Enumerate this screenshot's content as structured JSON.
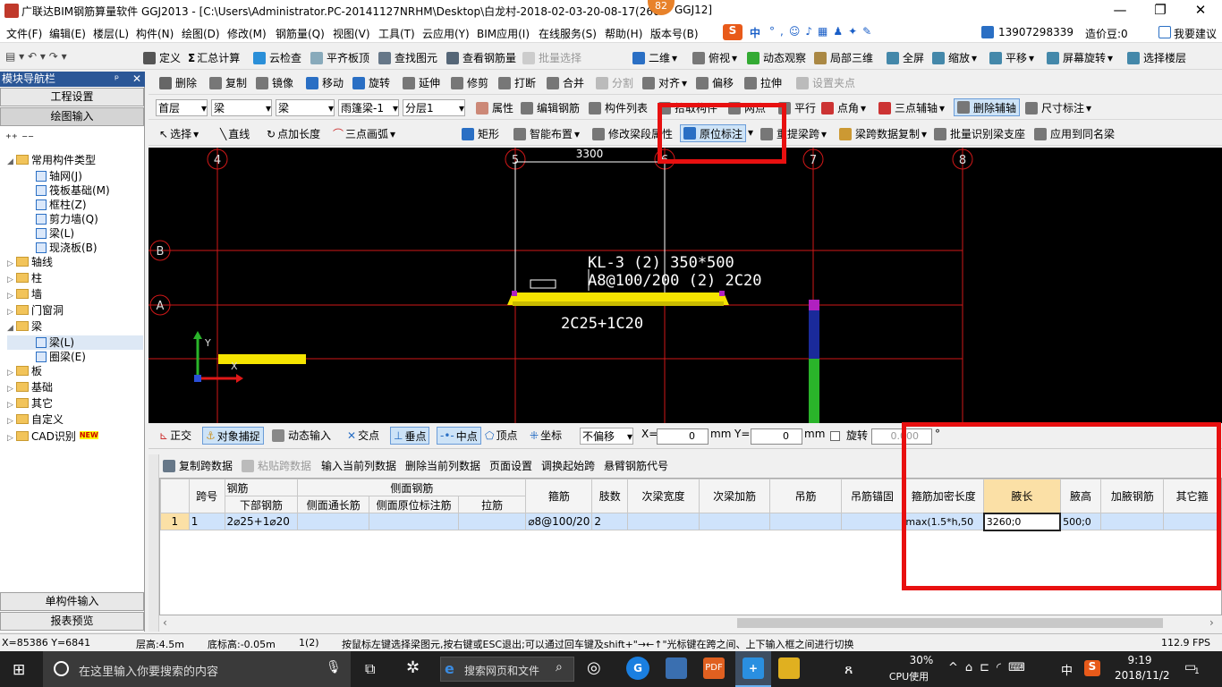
{
  "titlebar": {
    "title": "广联达BIM钢筋算量软件 GGJ2013 - [C:\\Users\\Administrator.PC-20141127NRHM\\Desktop\\白龙村-2018-02-03-20-08-17(266",
    "title_tail": "GGJ12]",
    "badge": "82",
    "min": "—",
    "max": "❐",
    "close": "✕"
  },
  "menu": [
    "文件(F)",
    "编辑(E)",
    "楼层(L)",
    "构件(N)",
    "绘图(D)",
    "修改(M)",
    "钢筋量(Q)",
    "视图(V)",
    "工具(T)",
    "云应用(Y)",
    "BIM应用(I)",
    "在线服务(S)",
    "帮助(H)",
    "版本号(B)"
  ],
  "menu_right": {
    "sogou": "中",
    "phone": "13907298339",
    "cost": "造价豆:0",
    "suggest": "我要建议"
  },
  "toolbar1": [
    "定义",
    "汇总计算",
    "云检查",
    "平齐板顶",
    "查找图元",
    "查看钢筋量",
    "批量选择",
    "二维",
    "俯视",
    "动态观察",
    "局部三维",
    "全屏",
    "缩放",
    "平移",
    "屏幕旋转",
    "选择楼层"
  ],
  "toolbar2": [
    "删除",
    "复制",
    "镜像",
    "移动",
    "旋转",
    "延伸",
    "修剪",
    "打断",
    "合并",
    "分割",
    "对齐",
    "偏移",
    "拉伸",
    "设置夹点"
  ],
  "toolbar3": {
    "floor": "首层",
    "cat": "梁",
    "type": "梁",
    "elem": "雨篷梁-1",
    "layer": "分层1",
    "items": [
      "属性",
      "编辑钢筋",
      "构件列表",
      "拾取构件",
      "两点",
      "平行",
      "点角",
      "三点辅轴",
      "删除辅轴",
      "尺寸标注"
    ]
  },
  "toolbar4": [
    "选择",
    "直线",
    "点加长度",
    "三点画弧",
    "矩形",
    "智能布置",
    "修改梁段属性",
    "原位标注",
    "重提梁跨",
    "梁跨数据复制",
    "批量识别梁支座",
    "应用到同名梁"
  ],
  "nav": {
    "header": "模块导航栏",
    "pin": "ᵖ",
    "close": "✕",
    "btn1": "工程设置",
    "btn2": "绘图输入",
    "btn3": "单构件输入",
    "btn4": "报表预览",
    "tree": [
      {
        "label": "常用构件类型",
        "lvl": 0,
        "type": "fold",
        "open": true
      },
      {
        "label": "轴网(J)",
        "lvl": 1,
        "type": "leaf"
      },
      {
        "label": "筏板基础(M)",
        "lvl": 1,
        "type": "leaf"
      },
      {
        "label": "框柱(Z)",
        "lvl": 1,
        "type": "leaf"
      },
      {
        "label": "剪力墙(Q)",
        "lvl": 1,
        "type": "leaf"
      },
      {
        "label": "梁(L)",
        "lvl": 1,
        "type": "leaf"
      },
      {
        "label": "现浇板(B)",
        "lvl": 1,
        "type": "leaf"
      },
      {
        "label": "轴线",
        "lvl": 0,
        "type": "fold"
      },
      {
        "label": "柱",
        "lvl": 0,
        "type": "fold"
      },
      {
        "label": "墙",
        "lvl": 0,
        "type": "fold"
      },
      {
        "label": "门窗洞",
        "lvl": 0,
        "type": "fold"
      },
      {
        "label": "梁",
        "lvl": 0,
        "type": "fold",
        "open": true
      },
      {
        "label": "梁(L)",
        "lvl": 1,
        "type": "leaf",
        "sel": true
      },
      {
        "label": "圈梁(E)",
        "lvl": 1,
        "type": "leaf"
      },
      {
        "label": "板",
        "lvl": 0,
        "type": "fold"
      },
      {
        "label": "基础",
        "lvl": 0,
        "type": "fold"
      },
      {
        "label": "其它",
        "lvl": 0,
        "type": "fold"
      },
      {
        "label": "自定义",
        "lvl": 0,
        "type": "fold"
      },
      {
        "label": "CAD识别",
        "lvl": 0,
        "type": "fold",
        "new": "NEW"
      }
    ]
  },
  "canvas": {
    "axes_top": [
      "4",
      "5",
      "6",
      "7",
      "8"
    ],
    "axes_left": [
      "B",
      "A"
    ],
    "dim": "3300",
    "beam_name": "KL-3 (2) 350*500",
    "beam_top": "A8@100/200 (2) 2C20",
    "beam_bottom": "2C25+1C20",
    "ucs_y": "Y",
    "ucs_x": "X"
  },
  "snapbar": {
    "items": [
      "正交",
      "对象捕捉",
      "动态输入",
      "交点",
      "垂点",
      "中点",
      "顶点",
      "坐标"
    ],
    "offset": "不偏移",
    "x_label": "X=",
    "x_val": "0",
    "unit": "mm",
    "y_label": "Y=",
    "y_val": "0",
    "rot_label": "旋转",
    "rot_val": "0.000",
    "deg": "°"
  },
  "gridbar": [
    "复制跨数据",
    "粘贴跨数据",
    "输入当前列数据",
    "删除当前列数据",
    "页面设置",
    "调换起始跨",
    "悬臂钢筋代号"
  ],
  "grid": {
    "h_top": [
      "跨号",
      "钢筋",
      "侧面钢筋",
      "箍筋",
      "肢数",
      "次梁宽度",
      "次梁加筋",
      "吊筋",
      "吊筋锚固",
      "箍筋加密长度",
      "腋长",
      "腋高",
      "加腋钢筋",
      "其它箍"
    ],
    "h_sub": [
      "下部钢筋",
      "侧面通长筋",
      "侧面原位标注筋",
      "拉筋"
    ],
    "row": {
      "idx": "1",
      "span": "1",
      "bottom": "2⌀25+1⌀20",
      "stirrup": "⌀8@100/20",
      "legs": "2",
      "dense": "max(1.5*h,50",
      "haunch_len": "3260;0",
      "haunch_h": "500;0"
    }
  },
  "status": {
    "coords": "X=85386 Y=6841",
    "floor_h": "层高:4.5m",
    "base": "底标高:-0.05m",
    "span": "1(2)",
    "hint": "按鼠标左键选择梁图元,按右键或ESC退出;可以通过回车键及shift+\"→←↑\"光标键在跨之间、上下输入框之间进行切换",
    "fps": "112.9 FPS"
  },
  "taskbar": {
    "search": "在这里输入你要搜索的内容",
    "edge_search": "搜索网页和文件",
    "cpu": "30%",
    "cpu_label": "CPU使用",
    "ime": "中",
    "time": "9:19",
    "date": "2018/11/2",
    "notif": "1"
  }
}
